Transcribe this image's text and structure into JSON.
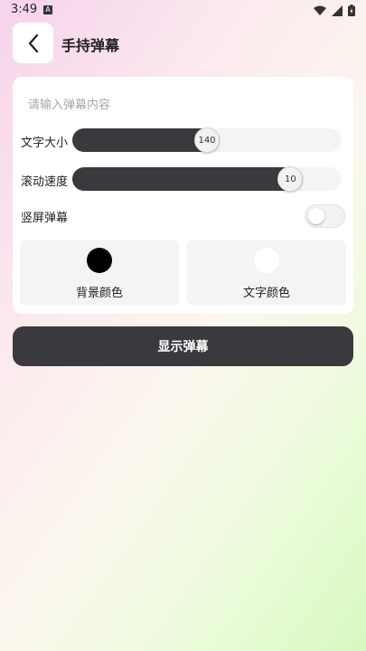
{
  "status_bar": {
    "time": "3:49",
    "notification_letter": "A"
  },
  "header": {
    "title": "手持弹幕"
  },
  "form": {
    "input": {
      "placeholder": "请输入弹幕内容",
      "value": ""
    },
    "font_size": {
      "label": "文字大小",
      "value": "140",
      "fraction": 0.5
    },
    "scroll_speed": {
      "label": "滚动速度",
      "value": "10",
      "fraction": 0.81
    },
    "portrait": {
      "label": "竖屏弹幕",
      "enabled": false
    },
    "background_color": {
      "label": "背景颜色",
      "color": "#000000"
    },
    "text_color": {
      "label": "文字颜色",
      "color": "#ffffff"
    }
  },
  "action": {
    "label": "显示弹幕"
  },
  "colors": {
    "accent": "#3a393e",
    "card": "#ffffff",
    "tile": "#f4f4f4"
  }
}
